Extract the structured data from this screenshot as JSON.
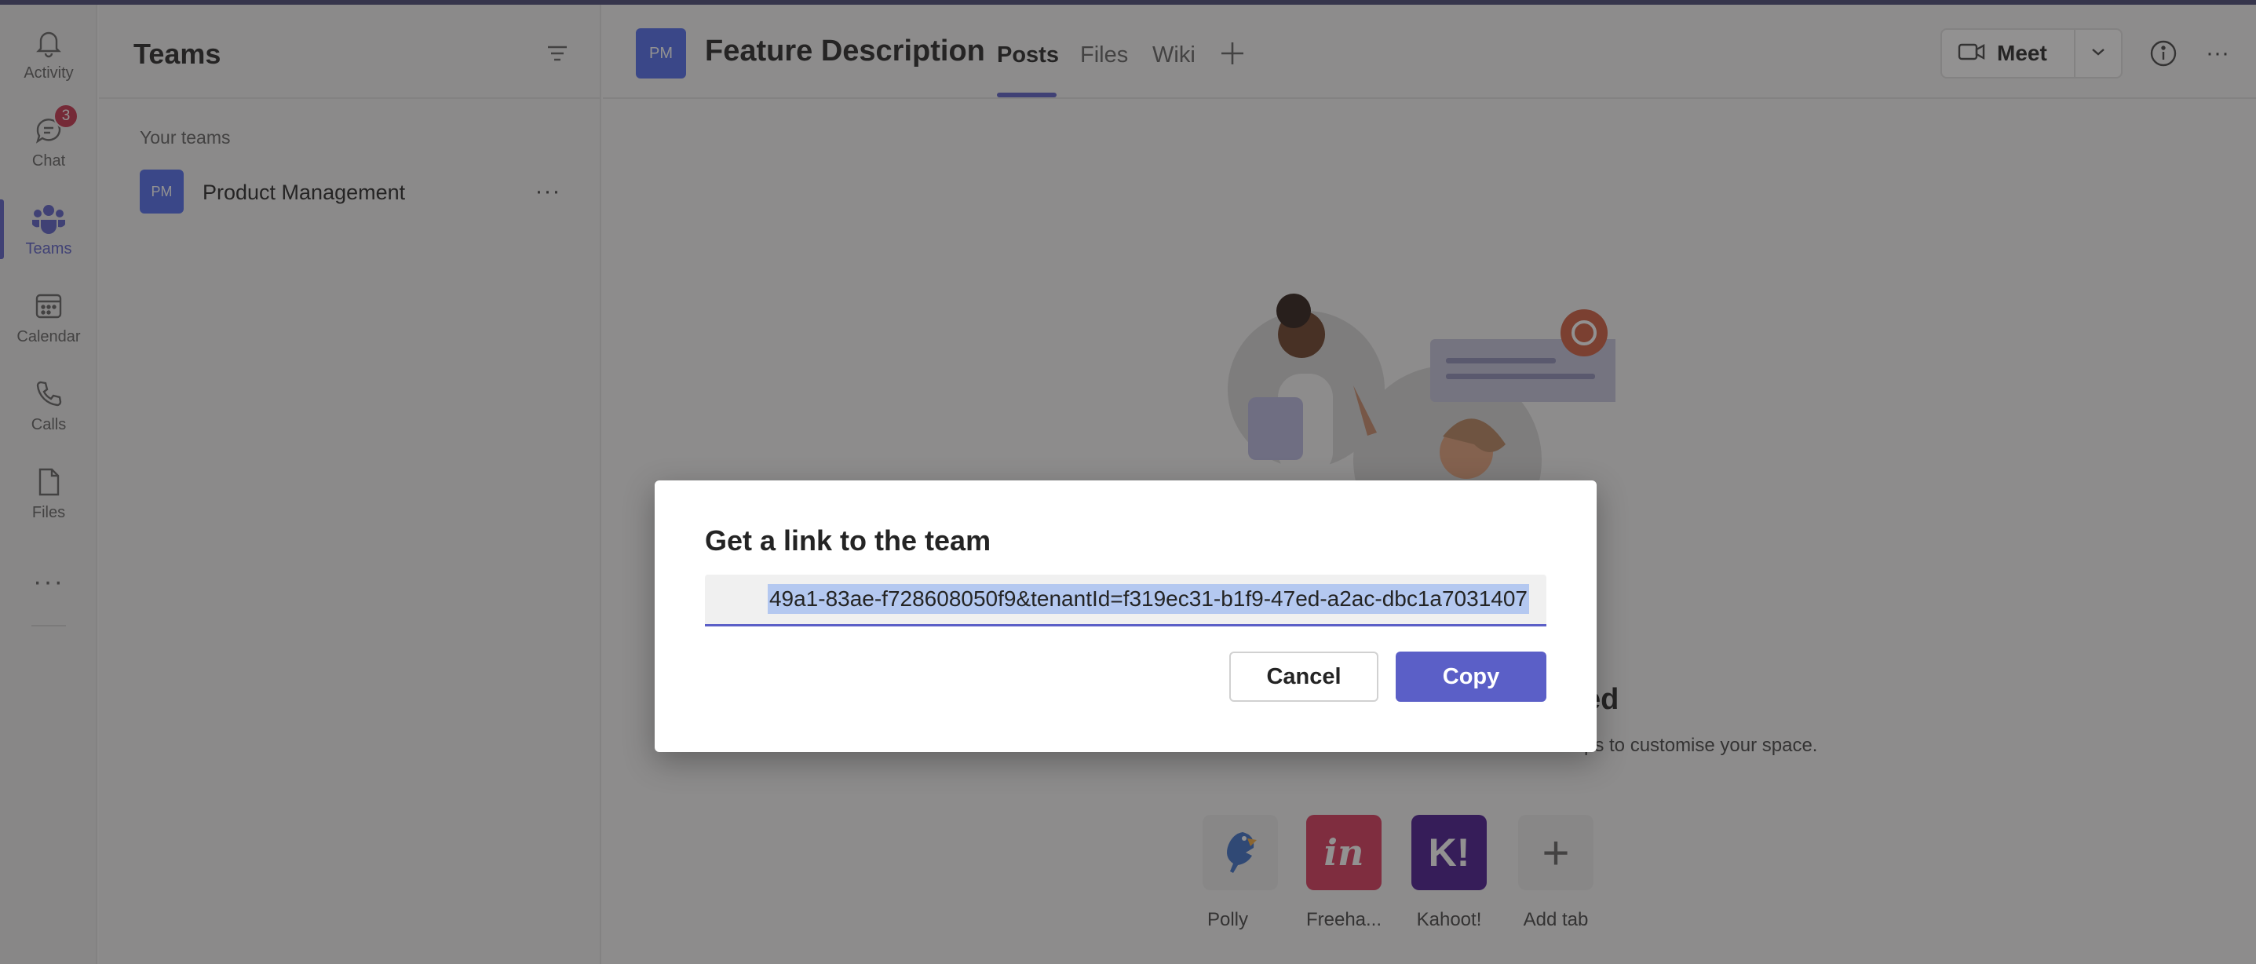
{
  "rail": {
    "items": [
      {
        "label": "Activity",
        "icon": "bell-icon"
      },
      {
        "label": "Chat",
        "icon": "chat-icon",
        "badge": "3"
      },
      {
        "label": "Teams",
        "icon": "teams-icon",
        "active": true
      },
      {
        "label": "Calendar",
        "icon": "calendar-icon"
      },
      {
        "label": "Calls",
        "icon": "phone-icon"
      },
      {
        "label": "Files",
        "icon": "file-icon"
      }
    ],
    "more": "···"
  },
  "teams_pane": {
    "title": "Teams",
    "section_label": "Your teams",
    "teams": [
      {
        "avatar": "PM",
        "name": "Product Management"
      }
    ]
  },
  "channel": {
    "avatar": "PM",
    "title": "Feature Description",
    "tabs": [
      "Posts",
      "Files",
      "Wiki"
    ],
    "active_tab": "Posts",
    "meet_label": "Meet"
  },
  "empty_state": {
    "heading_visible": "ed",
    "sub_visible": "ps to customise your space."
  },
  "apps": [
    {
      "label": "Polly",
      "color": "#eaeaea"
    },
    {
      "label": "Freeha...",
      "color": "#d8365a",
      "glyph": "in"
    },
    {
      "label": "Kahoot!",
      "color": "#46178f",
      "glyph": "K!"
    },
    {
      "label": "Add tab",
      "color": "#eaeaea",
      "glyph": "+"
    }
  ],
  "dialog": {
    "title": "Get a link to the team",
    "link_visible": "49a1-83ae-f728608050f9&tenantId=f319ec31-b1f9-47ed-a2ac-dbc1a7031407",
    "cancel_label": "Cancel",
    "copy_label": "Copy"
  },
  "colors": {
    "brand": "#5b5fc7",
    "header_strip": "#464775",
    "badge": "#c4314b",
    "team_avatar": "#4f6bed"
  }
}
